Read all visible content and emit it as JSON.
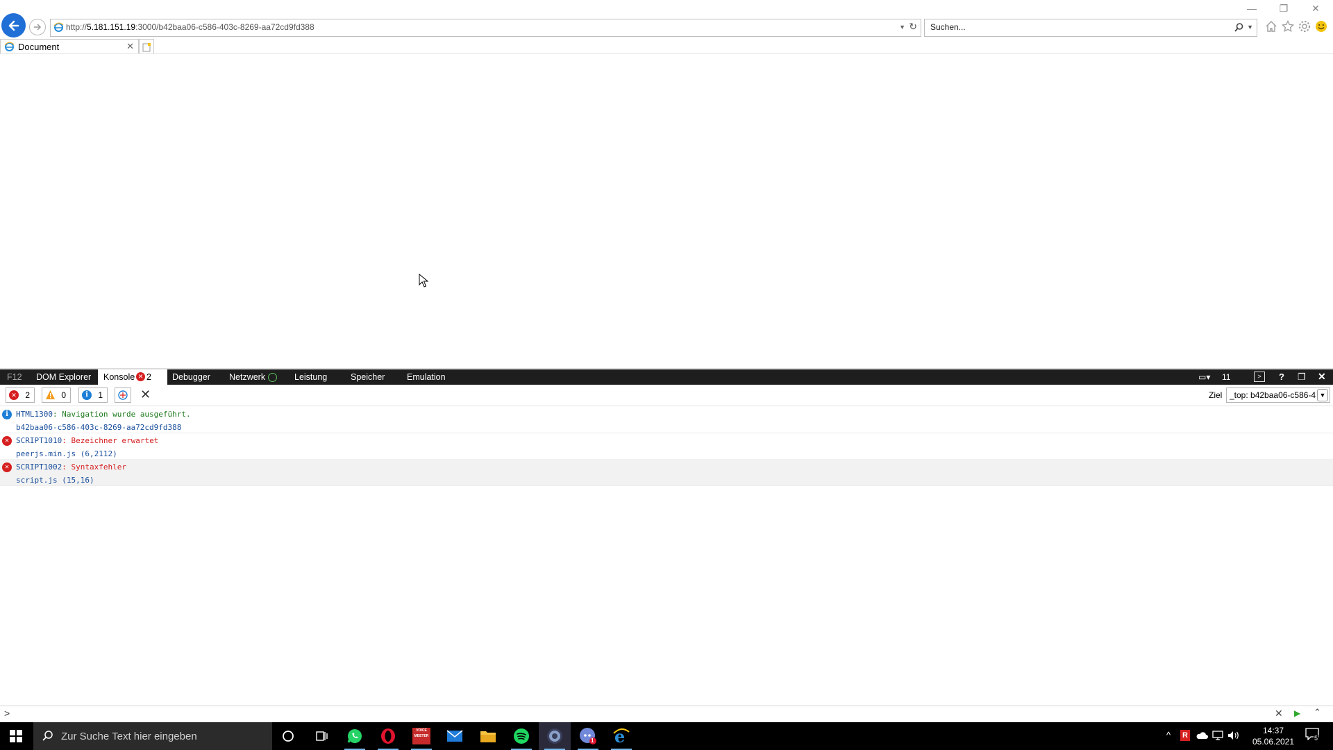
{
  "browser": {
    "url_prefix": "http://",
    "url_host": "5.181.151.19",
    "url_rest": ":3000/b42baa06-c586-403c-8269-aa72cd9fd388",
    "search_placeholder": "Suchen...",
    "tab_title": "Document"
  },
  "devtools": {
    "tabs": [
      "F12",
      "DOM Explorer",
      "Konsole",
      "Debugger",
      "Netzwerk",
      "Leistung",
      "Speicher",
      "Emulation"
    ],
    "console_error_badge": "2",
    "toolbar_right": {
      "doc_mode": "11"
    },
    "filters": {
      "errors": "2",
      "warnings": "0",
      "infos": "1"
    },
    "target_label": "Ziel",
    "target_value": "_top: b42baa06-c586-4(",
    "messages": [
      {
        "type": "info",
        "code": "HTML1300",
        "text": ": Navigation wurde ausgeführt.",
        "source": "b42baa06-c586-403c-8269-aa72cd9fd388"
      },
      {
        "type": "error",
        "code": "SCRIPT1010",
        "text": ": Bezeichner erwartet",
        "source": "peerjs.min.js (6,2112)"
      },
      {
        "type": "error",
        "code": "SCRIPT1002",
        "text": ": Syntaxfehler",
        "source": "script.js (15,16)"
      }
    ],
    "prompt": ">"
  },
  "taskbar": {
    "search_placeholder": "Zur Suche Text hier eingeben",
    "apps": [
      "cortana-icon",
      "task-view-icon",
      "whatsapp-icon",
      "opera-icon",
      "voicemeeter-icon",
      "mail-icon",
      "file-explorer-icon",
      "spotify-icon",
      "obs-icon",
      "discord-icon",
      "internet-explorer-icon"
    ],
    "voicemeeter_label": "VOICE MEETER",
    "time": "14:37",
    "date": "05.06.2021",
    "notification_count": "5",
    "discord_badge": "1"
  },
  "colors": {
    "accent": "#1f6fd6",
    "error": "#d61f1f",
    "info": "#1d7fd6",
    "devtools_bar": "#1e1e1e"
  }
}
